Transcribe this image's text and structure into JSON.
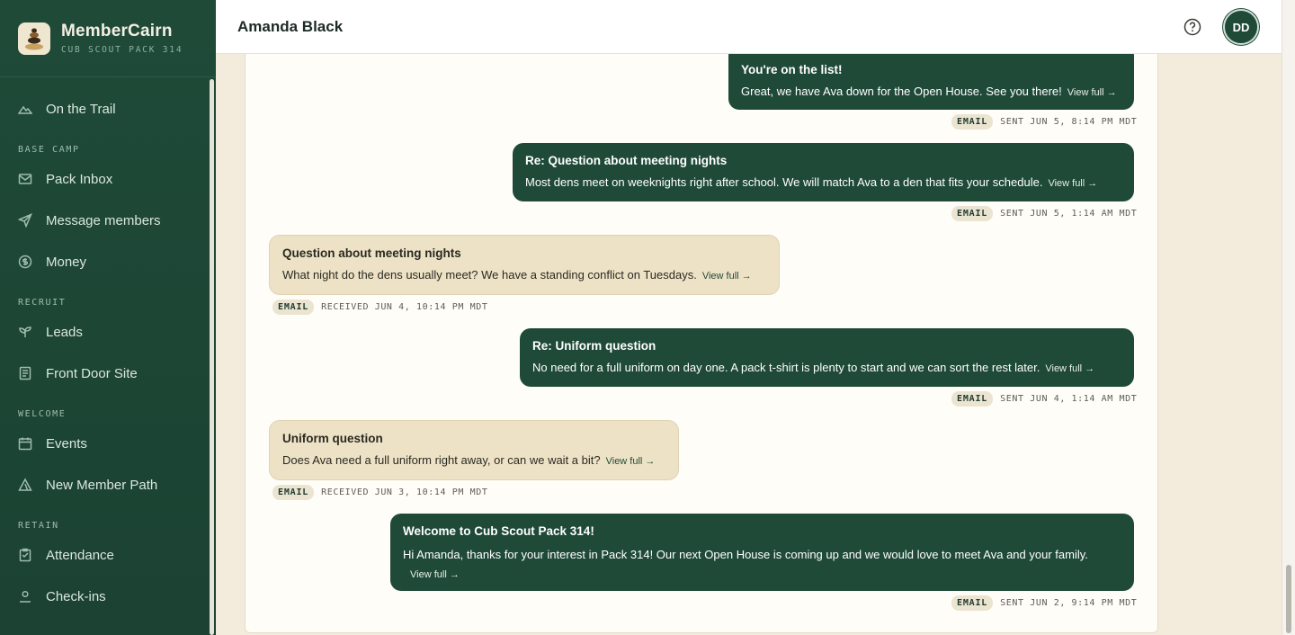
{
  "brand": {
    "name": "MemberCairn",
    "subtitle": "CUB SCOUT PACK 314"
  },
  "nav": {
    "on_the_trail": "On the Trail",
    "section_base_camp": "BASE CAMP",
    "pack_inbox": "Pack Inbox",
    "message_members": "Message members",
    "money": "Money",
    "section_recruit": "RECRUIT",
    "leads": "Leads",
    "front_door_site": "Front Door Site",
    "section_welcome": "WELCOME",
    "events": "Events",
    "new_member_path": "New Member Path",
    "section_retain": "RETAIN",
    "attendance": "Attendance",
    "check_ins": "Check-ins"
  },
  "header": {
    "title": "Amanda Black",
    "avatar_initials": "DD"
  },
  "messages": [
    {
      "direction": "sent",
      "subject": "You're on the list!",
      "body": "Great, we have Ava down for the Open House. See you there!",
      "view_label": "View full →",
      "channel": "EMAIL",
      "meta": "SENT JUN 5, 8:14 PM MDT"
    },
    {
      "direction": "sent",
      "subject": "Re: Question about meeting nights",
      "body": "Most dens meet on weeknights right after school. We will match Ava to a den that fits your schedule.",
      "view_label": "View full →",
      "channel": "EMAIL",
      "meta": "SENT JUN 5, 1:14 AM MDT"
    },
    {
      "direction": "received",
      "subject": "Question about meeting nights",
      "body": "What night do the dens usually meet? We have a standing conflict on Tuesdays.",
      "view_label": "View full →",
      "channel": "EMAIL",
      "meta": "RECEIVED JUN 4, 10:14 PM MDT"
    },
    {
      "direction": "sent",
      "subject": "Re: Uniform question",
      "body": "No need for a full uniform on day one. A pack t-shirt is plenty to start and we can sort the rest later.",
      "view_label": "View full →",
      "channel": "EMAIL",
      "meta": "SENT JUN 4, 1:14 AM MDT"
    },
    {
      "direction": "received",
      "subject": "Uniform question",
      "body": "Does Ava need a full uniform right away, or can we wait a bit?",
      "view_label": "View full →",
      "channel": "EMAIL",
      "meta": "RECEIVED JUN 3, 10:14 PM MDT"
    },
    {
      "direction": "sent",
      "subject": "Welcome to Cub Scout Pack 314!",
      "body": "Hi Amanda, thanks for your interest in Pack 314! Our next Open House is coming up and we would love to meet Ava and your family.",
      "view_label": "View full →",
      "channel": "EMAIL",
      "meta": "SENT JUN 2, 9:14 PM MDT"
    }
  ],
  "colors": {
    "sidebar": "#1f4a38",
    "sent_bubble": "#1f4a38",
    "received_bubble": "#eee2c6",
    "page_bg": "#f3ecdc"
  },
  "icons": [
    "mountain-icon",
    "mail-icon",
    "send-icon",
    "dollar-icon",
    "sprout-icon",
    "page-icon",
    "calendar-icon",
    "triangle-icon",
    "clipboard-icon",
    "person-icon",
    "help-icon"
  ]
}
